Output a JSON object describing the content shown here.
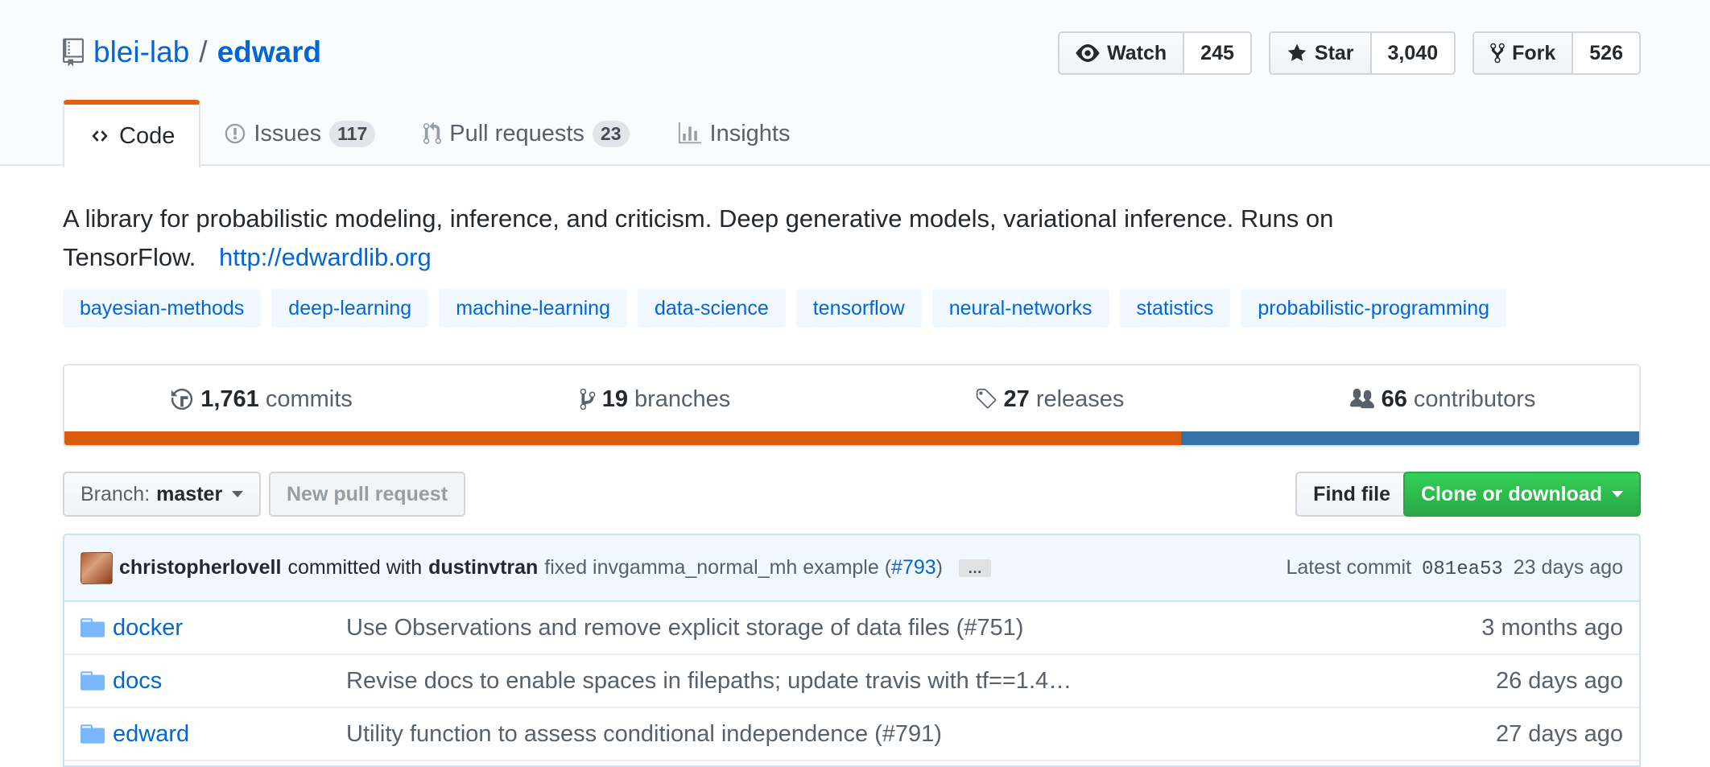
{
  "repo": {
    "owner": "blei-lab",
    "separator": "/",
    "name": "edward"
  },
  "actions": {
    "watch": {
      "label": "Watch",
      "count": "245"
    },
    "star": {
      "label": "Star",
      "count": "3,040"
    },
    "fork": {
      "label": "Fork",
      "count": "526"
    }
  },
  "tabs": [
    {
      "label": "Code",
      "icon": "code-icon"
    },
    {
      "label": "Issues",
      "counter": "117",
      "icon": "issue-icon"
    },
    {
      "label": "Pull requests",
      "counter": "23",
      "icon": "pull-request-icon"
    },
    {
      "label": "Insights",
      "icon": "graph-icon"
    }
  ],
  "description": {
    "text": "A library for probabilistic modeling, inference, and criticism. Deep generative models, variational inference. Runs on TensorFlow.",
    "homepage": "http://edwardlib.org"
  },
  "topics": [
    "bayesian-methods",
    "deep-learning",
    "machine-learning",
    "data-science",
    "tensorflow",
    "neural-networks",
    "statistics",
    "probabilistic-programming"
  ],
  "summary": {
    "commits": {
      "num": "1,761",
      "label": "commits"
    },
    "branches": {
      "num": "19",
      "label": "branches"
    },
    "releases": {
      "num": "27",
      "label": "releases"
    },
    "contributors": {
      "num": "66",
      "label": "contributors"
    }
  },
  "languages": [
    {
      "color": "#DA5B0B",
      "share": 0.709
    },
    {
      "color": "#3572A5",
      "share": 0.291
    }
  ],
  "file_nav": {
    "branch_prefix": "Branch:",
    "branch": "master",
    "new_pr": "New pull request",
    "find_file": "Find file",
    "clone": "Clone or download"
  },
  "latest_commit": {
    "author": "christopherlovell",
    "committed_with": "committed with",
    "committer": "dustinvtran",
    "message": "fixed invgamma_normal_mh example (",
    "pr": "#793",
    "message_end": ")",
    "ellipsis": "…",
    "label": "Latest commit",
    "sha": "081ea53",
    "age": "23 days ago"
  },
  "files": [
    {
      "name": "docker",
      "message": "Use Observations and remove explicit storage of data files (#751)",
      "age": "3 months ago"
    },
    {
      "name": "docs",
      "message": "Revise docs to enable spaces in filepaths; update travis with tf==1.4…",
      "age": "26 days ago"
    },
    {
      "name": "edward",
      "message": "Utility function to assess conditional independence (#791)",
      "age": "27 days ago"
    }
  ]
}
